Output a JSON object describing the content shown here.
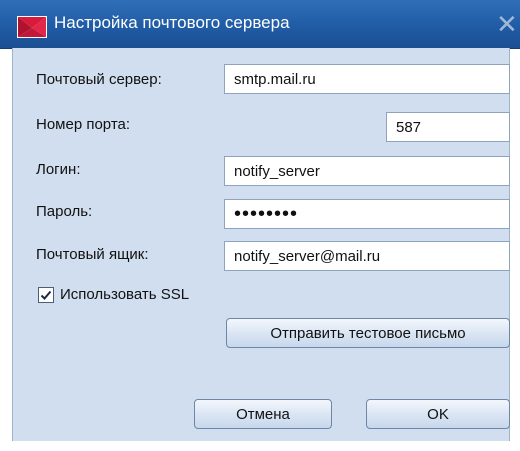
{
  "window": {
    "title": "Настройка почтового сервера",
    "close_glyph": "✕",
    "icon": "envelope-flag-icon"
  },
  "form": {
    "server_label": "Почтовый сервер:",
    "server_value": "smtp.mail.ru",
    "port_label": "Номер порта:",
    "port_value": "587",
    "login_label": "Логин:",
    "login_value": "notify_server",
    "password_label": "Пароль:",
    "password_value": "••••••••",
    "mailbox_label": "Почтовый ящик:",
    "mailbox_value": "notify_server@mail.ru",
    "ssl_label": "Использовать SSL",
    "ssl_checked": true
  },
  "buttons": {
    "test_email": "Отправить тестовое письмо",
    "cancel": "Отмена",
    "ok": "OK"
  },
  "colors": {
    "titlebar": "#1f5aa3",
    "client_bg": "#d1deef",
    "icon_red": "#d81b3a"
  }
}
